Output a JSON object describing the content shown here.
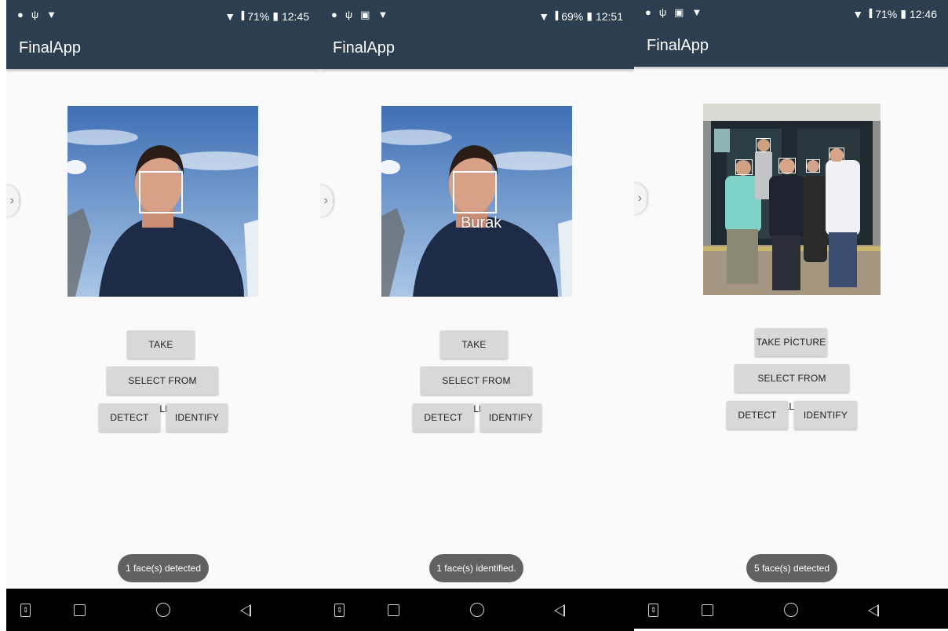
{
  "app": {
    "title": "FinalApp"
  },
  "buttons": {
    "take_picture": "TAKE PİCTURE",
    "select_from_gallery": "SELECT FROM GALLERY",
    "detect": "DETECT",
    "identify": "IDENTIFY"
  },
  "screens": [
    {
      "status": {
        "battery": "71%",
        "time": "12:45"
      },
      "face_label": "",
      "toast": "1 face(s) detected"
    },
    {
      "status": {
        "battery": "69%",
        "time": "12:51"
      },
      "face_label": "Burak",
      "toast": "1 face(s) identified."
    },
    {
      "status": {
        "battery": "71%",
        "time": "12:46"
      },
      "face_label": "",
      "toast": "5 face(s) detected"
    }
  ],
  "colors": {
    "app_bar": "#2c3e50",
    "button": "#d8d8d8",
    "toast": "#616161",
    "nav_bar": "#000000"
  },
  "icons": {
    "status_left": [
      "spotify-icon",
      "usb-icon",
      "android-debug-icon"
    ],
    "status_right": [
      "wifi-icon",
      "signal-icon",
      "battery-icon"
    ],
    "nav": [
      "screenshot-icon",
      "recent-apps-icon",
      "home-icon",
      "back-icon"
    ]
  }
}
